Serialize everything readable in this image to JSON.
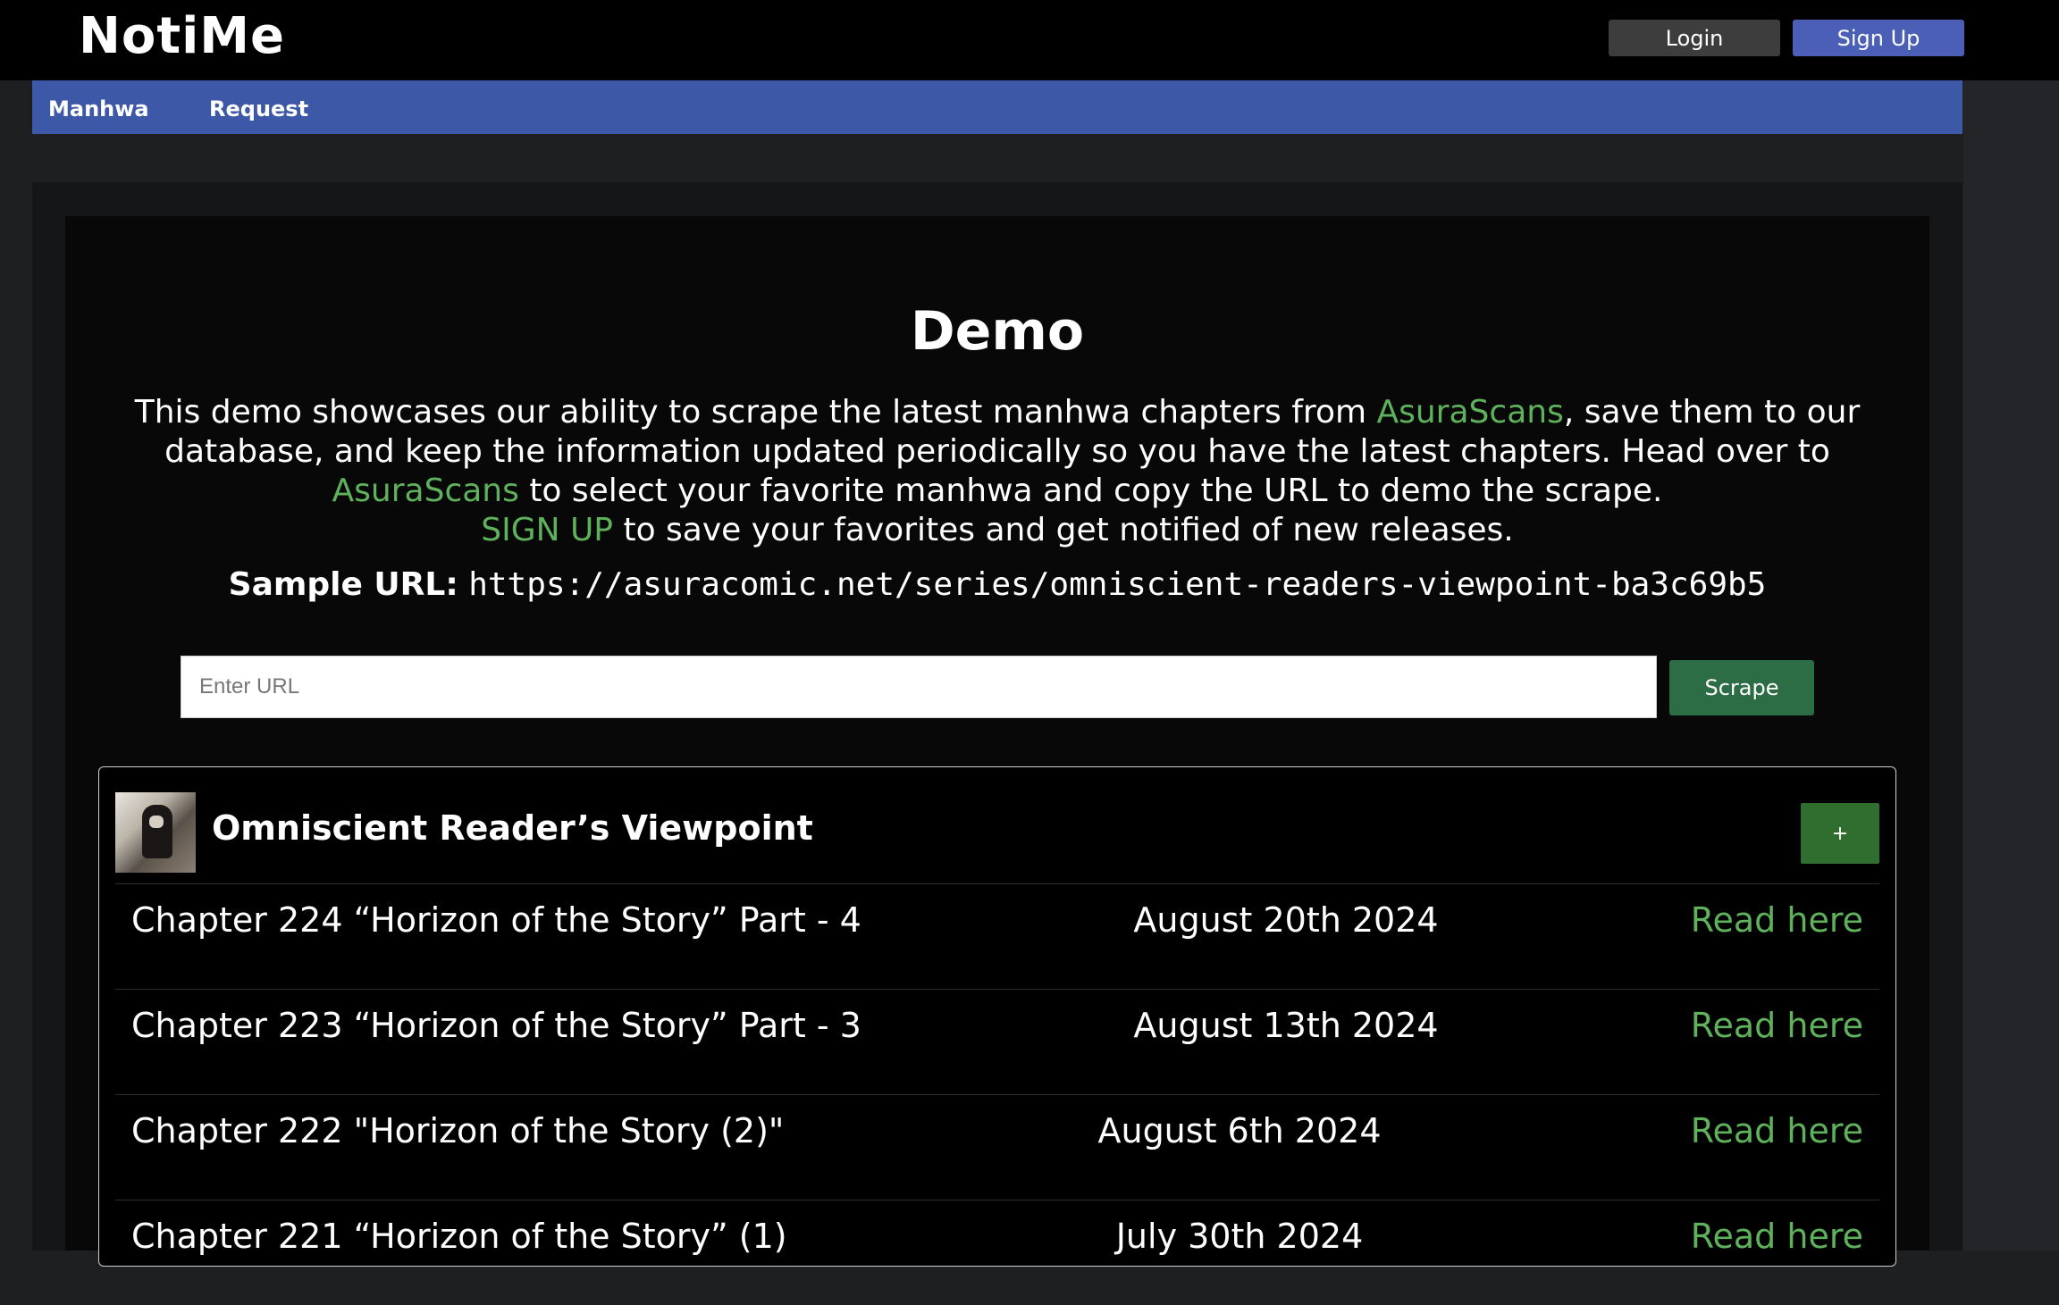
{
  "header": {
    "brand": "NotiMe",
    "login_label": "Login",
    "signup_label": "Sign Up"
  },
  "nav": {
    "items": [
      {
        "label": "Manhwa"
      },
      {
        "label": "Request"
      }
    ]
  },
  "demo": {
    "title": "Demo",
    "desc_part1": "This demo showcases our ability to scrape the latest manhwa chapters from ",
    "link_asura_1": "AsuraScans",
    "desc_part2": ", save them to our database, and keep the information updated periodically so you have the latest chapters. Head over to ",
    "link_asura_2": "AsuraScans",
    "desc_part3": " to select your favorite manhwa and copy the URL to demo the scrape.",
    "link_signup": "SIGN UP",
    "desc_part4": " to save your favorites and get notified of new releases.",
    "sample_label": "Sample URL:",
    "sample_url": "https://asuracomic.net/series/omniscient-readers-viewpoint-ba3c69b5",
    "input_placeholder": "Enter URL",
    "input_value": "",
    "scrape_label": "Scrape"
  },
  "series": {
    "title": "Omniscient Reader’s Viewpoint",
    "add_label": "+",
    "chapters": [
      {
        "title": "Chapter 224 “Horizon of the Story” Part - 4",
        "date": "August 20th 2024",
        "link": "Read here"
      },
      {
        "title": "Chapter 223 “Horizon of the Story” Part - 3",
        "date": "August 13th 2024",
        "link": "Read here"
      },
      {
        "title": "Chapter 222 \"Horizon of the Story (2)\"",
        "date": "August 6th 2024",
        "link": "Read here"
      },
      {
        "title": "Chapter 221 “Horizon of the Story” (1)",
        "date": "July 30th 2024",
        "link": "Read here"
      }
    ]
  },
  "colors": {
    "nav_bg": "#3c58a6",
    "link_green": "#5fb25c",
    "scrape_btn": "#2c6d46",
    "add_btn": "#2f6e2f",
    "signup_btn": "#4a5fb5"
  }
}
